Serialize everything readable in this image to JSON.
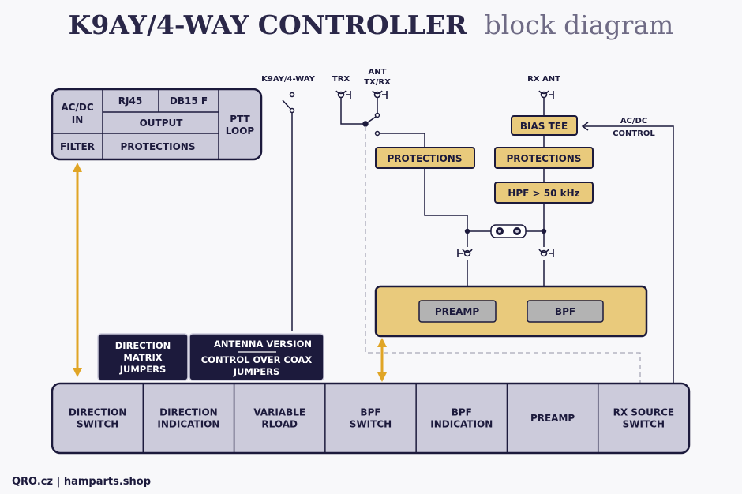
{
  "title": {
    "main": "K9AY/4-WAY CONTROLLER",
    "sub": "block diagram"
  },
  "colors": {
    "dark": "#1c1a3c",
    "panel": "#cccbdb",
    "gold": "#e9ca7c",
    "arrow": "#e0a526",
    "gray": "#b3b3b3",
    "dashed": "#a9a8b8"
  },
  "power_board": {
    "acdc_in": [
      "AC/DC",
      "IN"
    ],
    "rj45": "RJ45",
    "db15": "DB15 F",
    "output": "OUTPUT",
    "ptt_loop": [
      "PTT",
      "LOOP"
    ],
    "filter": "FILTER",
    "protections": "PROTECTIONS"
  },
  "connectors": {
    "k9ay": "K9AY/4-WAY",
    "trx": "TRX",
    "ant_txrx": [
      "ANT",
      "TX/RX"
    ],
    "rx_ant": "RX ANT"
  },
  "rf": {
    "bias_tee": "BIAS TEE",
    "acdc_control": [
      "AC/DC",
      "CONTROL"
    ],
    "protections_left": "PROTECTIONS",
    "protections_right": "PROTECTIONS",
    "hpf": "HPF > 50 kHz",
    "preamp": "PREAMP",
    "bpf": "BPF"
  },
  "jumpers": {
    "direction_matrix": [
      "DIRECTION",
      "MATRIX",
      "JUMPERS"
    ],
    "antenna_version": "ANTENNA VERSION",
    "control_coax": [
      "CONTROL OVER COAX",
      "JUMPERS"
    ]
  },
  "bottom_modules": [
    [
      "DIRECTION",
      "SWITCH"
    ],
    [
      "DIRECTION",
      "INDICATION"
    ],
    [
      "VARIABLE",
      "RLOAD"
    ],
    [
      "BPF",
      "SWITCH"
    ],
    [
      "BPF",
      "INDICATION"
    ],
    [
      "PREAMP"
    ],
    [
      "RX SOURCE",
      "SWITCH"
    ]
  ],
  "footer": "QRO.cz | hamparts.shop"
}
